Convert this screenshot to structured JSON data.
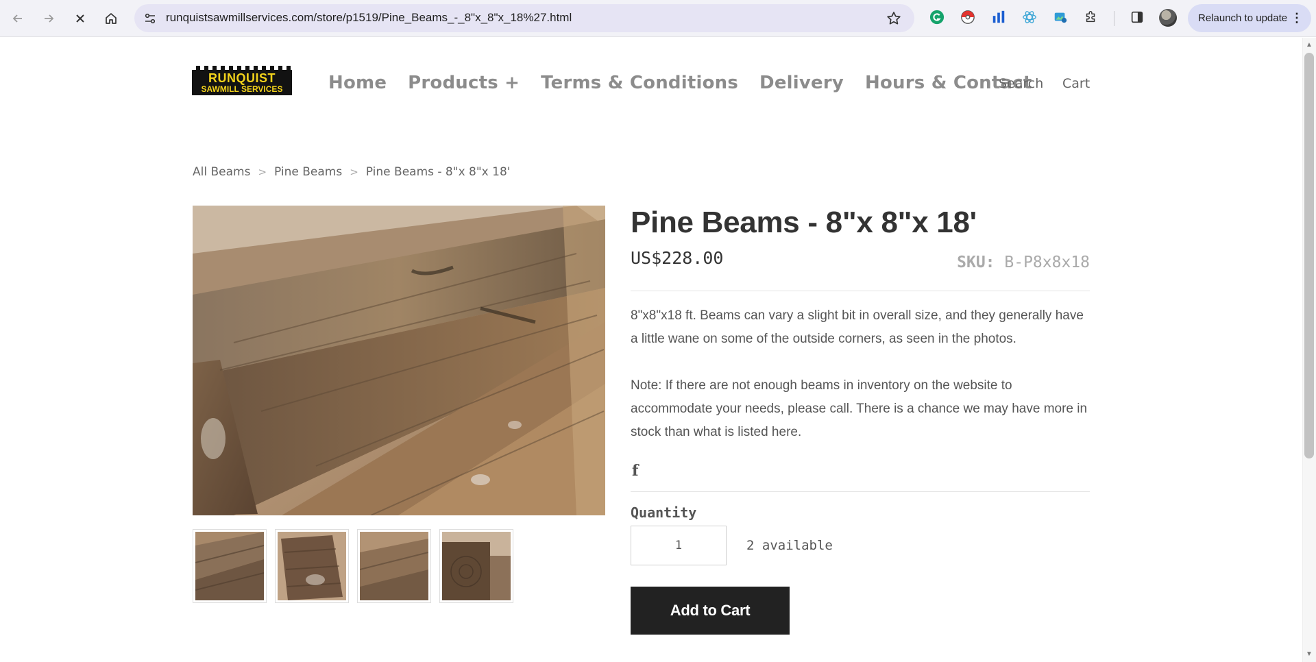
{
  "browser": {
    "url": "runquistsawmillservices.com/store/p1519/Pine_Beams_-_8\"x_8\"x_18%27.html",
    "relaunch_label": "Relaunch to update"
  },
  "site": {
    "logo_line1": "RUNQUIST",
    "logo_line2": "SAWMILL SERVICES",
    "nav": [
      "Home",
      "Products +",
      "Terms & Conditions",
      "Delivery",
      "Hours & Contact"
    ],
    "search_label": "Search",
    "cart_label": "Cart"
  },
  "breadcrumb": [
    "All Beams",
    "Pine Beams",
    "Pine Beams - 8\"x 8\"x 18'"
  ],
  "product": {
    "title": "Pine Beams - 8\"x 8\"x 18'",
    "price": "US$228.00",
    "sku_label": "SKU:",
    "sku_value": "B-P8x8x18",
    "description_1": "8\"x8\"x18 ft. Beams can vary a slight bit in overall size, and they generally have a little wane on some of the outside corners, as seen in the photos.",
    "description_2": "Note: If there are not enough beams in inventory on the website to accommodate your needs, please call. There is a chance we may have more in stock than what is listed here.",
    "facebook_glyph": "f",
    "quantity_label": "Quantity",
    "quantity_value": "1",
    "availability": "2 available",
    "add_to_cart_label": "Add to Cart"
  },
  "colors": {
    "logo_yellow": "#f2d21b",
    "button_dark": "#222222",
    "nav_gray": "#8c8c8c"
  }
}
